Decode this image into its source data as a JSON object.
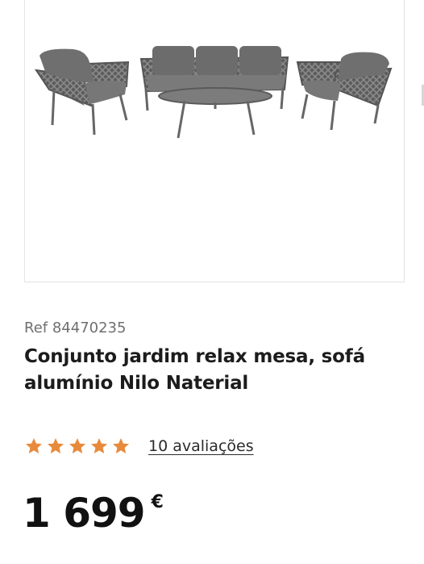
{
  "product": {
    "ref": "Ref 84470235",
    "title": "Conjunto jardim relax mesa, sofá alumínio Nilo Naterial",
    "rating": 5,
    "max_rating": 5,
    "reviews_label": "10 avaliações",
    "price": "1 699",
    "currency": "€"
  },
  "colors": {
    "star": "#e88a3c",
    "text": "#1f1f1f",
    "muted": "#6f6f6f"
  },
  "icons": {
    "star": "star-icon"
  }
}
